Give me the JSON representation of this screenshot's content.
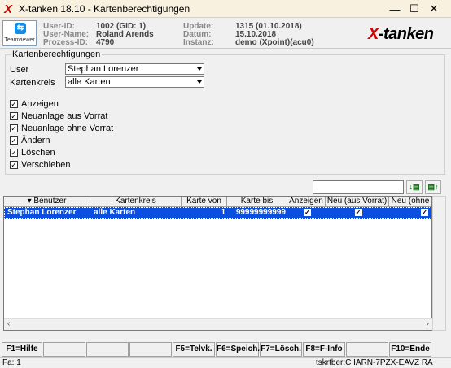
{
  "window": {
    "logo": "X",
    "title": "X-tanken 18.10 - Kartenberechtigungen",
    "min_glyph": "—",
    "max_glyph": "☐",
    "close_glyph": "✕"
  },
  "header": {
    "teamviewer_label": "Teamviewer",
    "userid_label": "User-ID:",
    "userid_value": "1002 (GID: 1)",
    "username_label": "User-Name:",
    "username_value": "Roland Arends",
    "process_label": "Prozess-ID:",
    "process_value": "4790",
    "update_label": "Update:",
    "update_value": "1315 (01.10.2018)",
    "datum_label": "Datum:",
    "datum_value": "15.10.2018",
    "instanz_label": "Instanz:",
    "instanz_value": "demo (Xpoint)(acu0)",
    "brand_x": "X",
    "brand_rest": "-tanken"
  },
  "group": {
    "legend": "Kartenberechtigungen",
    "user_label": "User",
    "user_value": "Stephan Lorenzer",
    "kreis_label": "Kartenkreis",
    "kreis_value": "alle Karten",
    "checkboxes": [
      {
        "label": "Anzeigen",
        "checked": true
      },
      {
        "label": "Neuanlage aus Vorrat",
        "checked": true
      },
      {
        "label": "Neuanlage ohne Vorrat",
        "checked": true
      },
      {
        "label": "Ändern",
        "checked": true
      },
      {
        "label": "Löschen",
        "checked": true
      },
      {
        "label": "Verschieben",
        "checked": true
      }
    ]
  },
  "search": {
    "value": ""
  },
  "table": {
    "columns": [
      "Benutzer",
      "Kartenkreis",
      "Karte von",
      "Karte bis",
      "Anzeigen",
      "Neu (aus Vorrat)",
      "Neu (ohne"
    ],
    "rows": [
      {
        "benutzer": "Stephan Lorenzer",
        "kartenkreis": "alle Karten",
        "von": "1",
        "bis": "99999999999",
        "anzeigen": true,
        "neu_vorrat": true,
        "neu_ohne": true
      }
    ]
  },
  "fkeys": [
    "F1=Hilfe",
    "",
    "",
    "",
    "F5=Telvk.",
    "F6=Speich.",
    "F7=Lösch.",
    "F8=F-Info",
    "",
    "F10=Ende"
  ],
  "status": {
    "left": "Fa: 1",
    "right": "tskrtber:C IARN-7PZX-EAVZ RA"
  },
  "check_glyph": "✓"
}
